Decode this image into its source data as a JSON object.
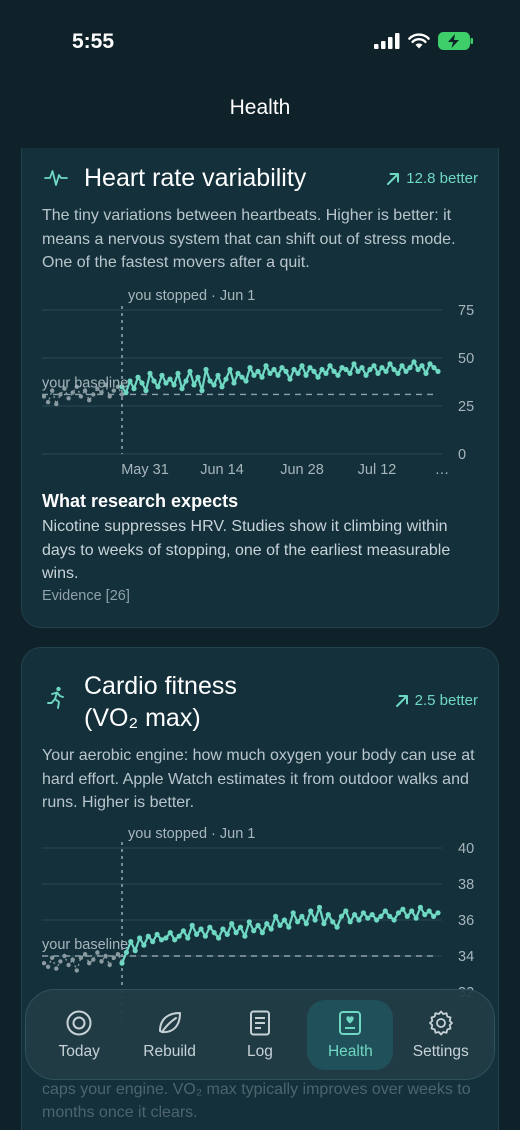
{
  "status": {
    "time": "5:55"
  },
  "nav": {
    "title": "Health"
  },
  "hrv": {
    "title": "Heart rate variability",
    "delta": "12.8 better",
    "description": "The tiny variations between heartbeats. Higher is better: it means a nervous system that can shift out of stress mode. One of the fastest movers after a quit.",
    "chart_data": {
      "type": "line",
      "annotation": "you stopped · Jun 1",
      "baseline_label": "your baseline",
      "baseline": 31,
      "ylim": [
        0,
        75
      ],
      "y_ticks": [
        "75",
        "50",
        "25",
        "0"
      ],
      "x_ticks": [
        "May 31",
        "Jun 14",
        "Jun 28",
        "Jul 12",
        "…"
      ],
      "pre_quit_values": [
        30,
        27,
        33,
        26,
        31,
        34,
        29,
        32,
        35,
        30,
        33,
        28,
        31,
        34,
        32,
        36,
        30,
        33,
        35,
        31
      ],
      "post_quit_values": [
        35,
        32,
        38,
        34,
        40,
        37,
        33,
        42,
        38,
        35,
        41,
        37,
        39,
        36,
        42,
        34,
        38,
        43,
        36,
        40,
        33,
        44,
        38,
        36,
        41,
        35,
        39,
        44,
        37,
        42,
        40,
        38,
        45,
        41,
        43,
        40,
        46,
        42,
        44,
        41,
        45,
        43,
        39,
        44,
        42,
        46,
        41,
        45,
        43,
        40,
        44,
        42,
        46,
        43,
        41,
        45,
        44,
        42,
        47,
        43,
        45,
        41,
        44,
        46,
        42,
        45,
        43,
        47,
        44,
        42,
        46,
        43,
        45,
        48,
        44,
        46,
        42,
        47,
        45,
        43
      ]
    },
    "research": {
      "title": "What research expects",
      "body": "Nicotine suppresses HRV. Studies show it climbing within days to weeks of stopping, one of the earliest measurable wins.",
      "evidence": "Evidence [26]"
    }
  },
  "vo2": {
    "title": "Cardio fitness",
    "title_sub": "(VO₂ max)",
    "delta": "2.5 better",
    "description": "Your aerobic engine: how much oxygen your body can use at hard effort. Apple Watch estimates it from outdoor walks and runs. Higher is better.",
    "chart_data": {
      "type": "line",
      "annotation": "you stopped · Jun 1",
      "baseline_label": "your baseline",
      "baseline": 34,
      "ylim": [
        32,
        40
      ],
      "y_ticks": [
        "40",
        "38",
        "36",
        "34",
        "32"
      ],
      "pre_quit_values": [
        33.6,
        33.4,
        33.9,
        33.3,
        33.7,
        34.0,
        33.5,
        33.8,
        33.2,
        33.9,
        34.1,
        33.6,
        33.8,
        34.2,
        33.7,
        34.0,
        33.5,
        33.9,
        34.1,
        33.7
      ],
      "post_quit_values": [
        33.6,
        34.2,
        34.8,
        34.3,
        35.0,
        34.6,
        35.1,
        34.8,
        35.2,
        34.9,
        35.0,
        35.3,
        34.9,
        35.1,
        35.4,
        35.0,
        35.7,
        35.2,
        35.5,
        35.1,
        35.6,
        35.3,
        35.0,
        35.5,
        35.2,
        35.8,
        35.3,
        35.6,
        35.1,
        35.9,
        35.4,
        35.7,
        35.3,
        35.8,
        35.5,
        36.2,
        35.7,
        36.0,
        35.6,
        36.4,
        35.9,
        36.2,
        35.8,
        36.5,
        36.0,
        36.7,
        35.8,
        36.3,
        35.9,
        35.6,
        36.2,
        36.5,
        35.9,
        36.3,
        36.0,
        36.4,
        36.1,
        36.3,
        36.0,
        36.2,
        36.5,
        36.2,
        36.0,
        36.4,
        36.6,
        36.2,
        36.5,
        36.1,
        36.7,
        36.3,
        36.5,
        36.2,
        36.4
      ]
    },
    "faded_text": "caps your engine. VO₂ max typically improves over weeks to months once it clears."
  },
  "tabs": [
    {
      "label": "Today",
      "icon": "target-icon",
      "active": false
    },
    {
      "label": "Rebuild",
      "icon": "leaf-icon",
      "active": false
    },
    {
      "label": "Log",
      "icon": "document-icon",
      "active": false
    },
    {
      "label": "Health",
      "icon": "health-record-icon",
      "active": true
    },
    {
      "label": "Settings",
      "icon": "gear-icon",
      "active": false
    }
  ],
  "colors": {
    "accent": "#6fd8c2",
    "background": "#0f2129",
    "card": "#14303b"
  }
}
